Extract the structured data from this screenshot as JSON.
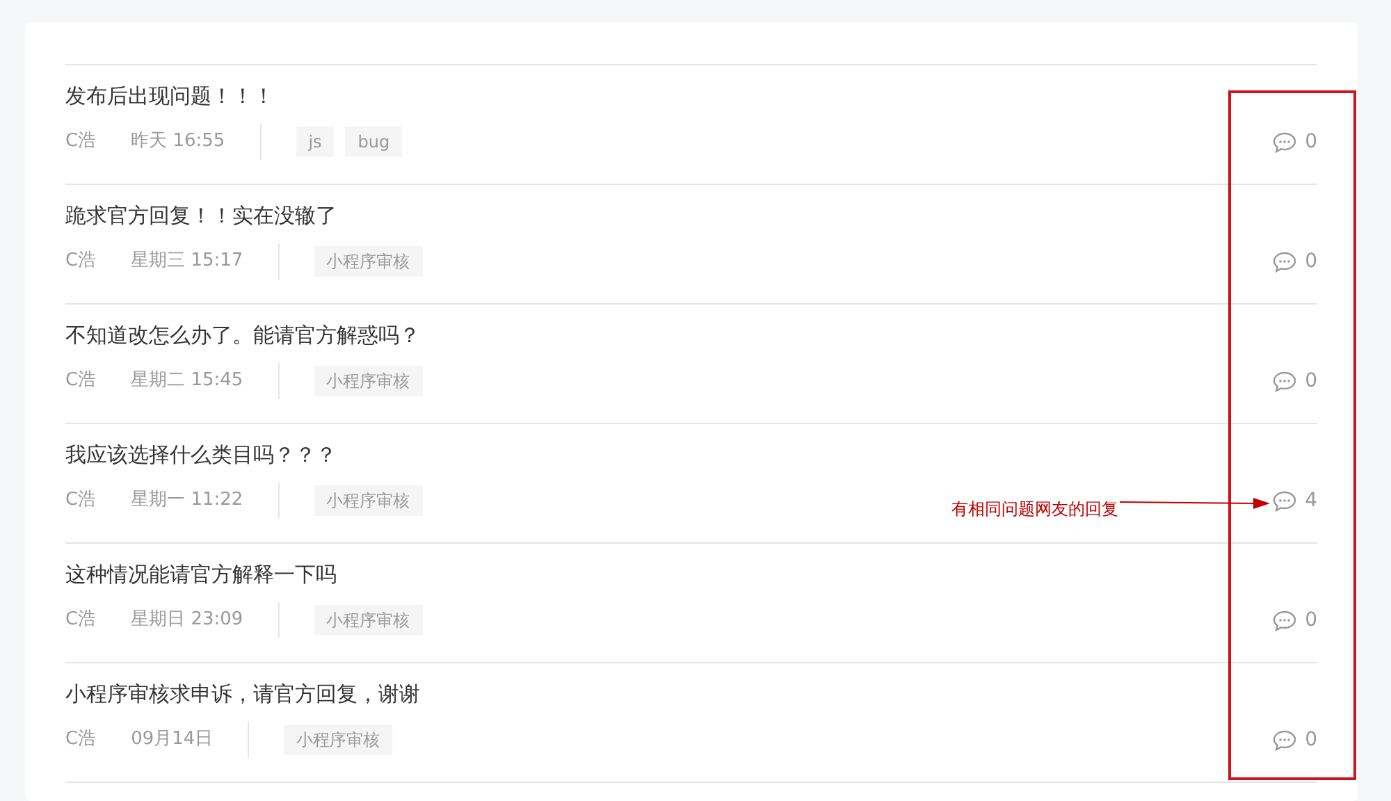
{
  "posts": [
    {
      "title": "发布后出现问题！！！",
      "author": "C浩",
      "time": "昨天 16:55",
      "tags": [
        "js",
        "bug"
      ],
      "replies": "0"
    },
    {
      "title": "跪求官方回复！！实在没辙了",
      "author": "C浩",
      "time": "星期三 15:17",
      "tags": [
        "小程序审核"
      ],
      "replies": "0"
    },
    {
      "title": "不知道改怎么办了。能请官方解惑吗？",
      "author": "C浩",
      "time": "星期二 15:45",
      "tags": [
        "小程序审核"
      ],
      "replies": "0"
    },
    {
      "title": "我应该选择什么类目吗？？？",
      "author": "C浩",
      "time": "星期一 11:22",
      "tags": [
        "小程序审核"
      ],
      "replies": "4"
    },
    {
      "title": "这种情况能请官方解释一下吗",
      "author": "C浩",
      "time": "星期日 23:09",
      "tags": [
        "小程序审核"
      ],
      "replies": "0"
    },
    {
      "title": "小程序审核求申诉，请官方回复，谢谢",
      "author": "C浩",
      "time": "09月14日",
      "tags": [
        "小程序审核"
      ],
      "replies": "0"
    }
  ],
  "annotation": {
    "text": "有相同问题网友的回复"
  }
}
